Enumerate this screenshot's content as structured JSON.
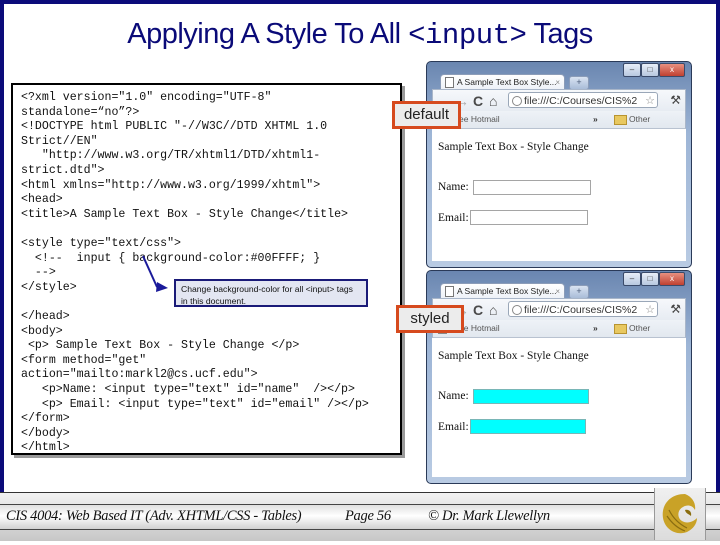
{
  "slide": {
    "title_prefix": "Applying A Style To All ",
    "title_code": "<input>",
    "title_suffix": " Tags"
  },
  "code_listing": {
    "lines": [
      "<?xml version=\"1.0\" encoding=\"UTF-8″",
      "standalone=“no”?>",
      "<!DOCTYPE html PUBLIC \"-//W3C//DTD XHTML 1.0",
      "Strict//EN\"",
      "   \"http://www.w3.org/TR/xhtml1/DTD/xhtml1-",
      "strict.dtd\">",
      "<html xmlns=\"http://www.w3.org/1999/xhtml\">",
      "<head>",
      "<title>A Sample Text Box - Style Change</title>",
      "",
      "<style type=\"text/css\">",
      "  <!--  input { background-color:#00FFFF; }",
      "  -->",
      "</style>",
      "",
      "</head>",
      "<body>",
      " <p> Sample Text Box - Style Change </p>",
      "<form method=\"get\"",
      "action=\"mailto:markl2@cs.ucf.edu\">",
      "   <p>Name: <input type=\"text\" id=\"name\"  /></p>",
      "   <p> Email: <input type=\"text\" id=\"email\" /></p>",
      "</form>",
      "</body>",
      "</html>"
    ]
  },
  "callout": {
    "text": "Change background-color for all <input> tags in this document."
  },
  "labels": {
    "default": "default",
    "styled": "styled"
  },
  "browsers": [
    {
      "tab_title": "A Sample Text Box   Style...",
      "tab_close": "×",
      "new_tab": "+",
      "url": "file:///C:/Courses/CIS%2",
      "bookmark_left": "Free Hotmail",
      "bookmark_chevron": "»",
      "bookmark_right": "Other bookmarks",
      "page_text": "Sample Text Box - Style Change",
      "name_label": "Name:",
      "email_label": "Email:",
      "name_value": "",
      "email_value": "",
      "input_bg": "#ffffff"
    },
    {
      "tab_title": "A Sample Text Box   Style...",
      "tab_close": "×",
      "new_tab": "+",
      "url": "file:///C:/Courses/CIS%2",
      "bookmark_left": "Free Hotmail",
      "bookmark_chevron": "»",
      "bookmark_right": "Other bookmarks",
      "page_text": "Sample Text Box - Style Change",
      "name_label": "Name:",
      "email_label": "Email:",
      "name_value": "",
      "email_value": "",
      "input_bg": "#00FFFF"
    }
  ],
  "window_controls": {
    "minimize": "–",
    "maximize": "□",
    "close": "x"
  },
  "nav_glyphs": {
    "back": "←",
    "forward": "→",
    "reload": "C",
    "home": "⌂",
    "star": "☆",
    "wrench": "⚒"
  },
  "footer": {
    "course": "CIS 4004: Web Based IT (Adv. XHTML/CSS - Tables)",
    "page": "Page 56",
    "copyright": "© Dr. Mark Llewellyn"
  },
  "colors": {
    "title": "#0a0a78",
    "frame": "#0b0b7a",
    "label_border": "#d64a1e",
    "styled_input": "#00FFFF",
    "logo_gold": "#c9a227"
  }
}
